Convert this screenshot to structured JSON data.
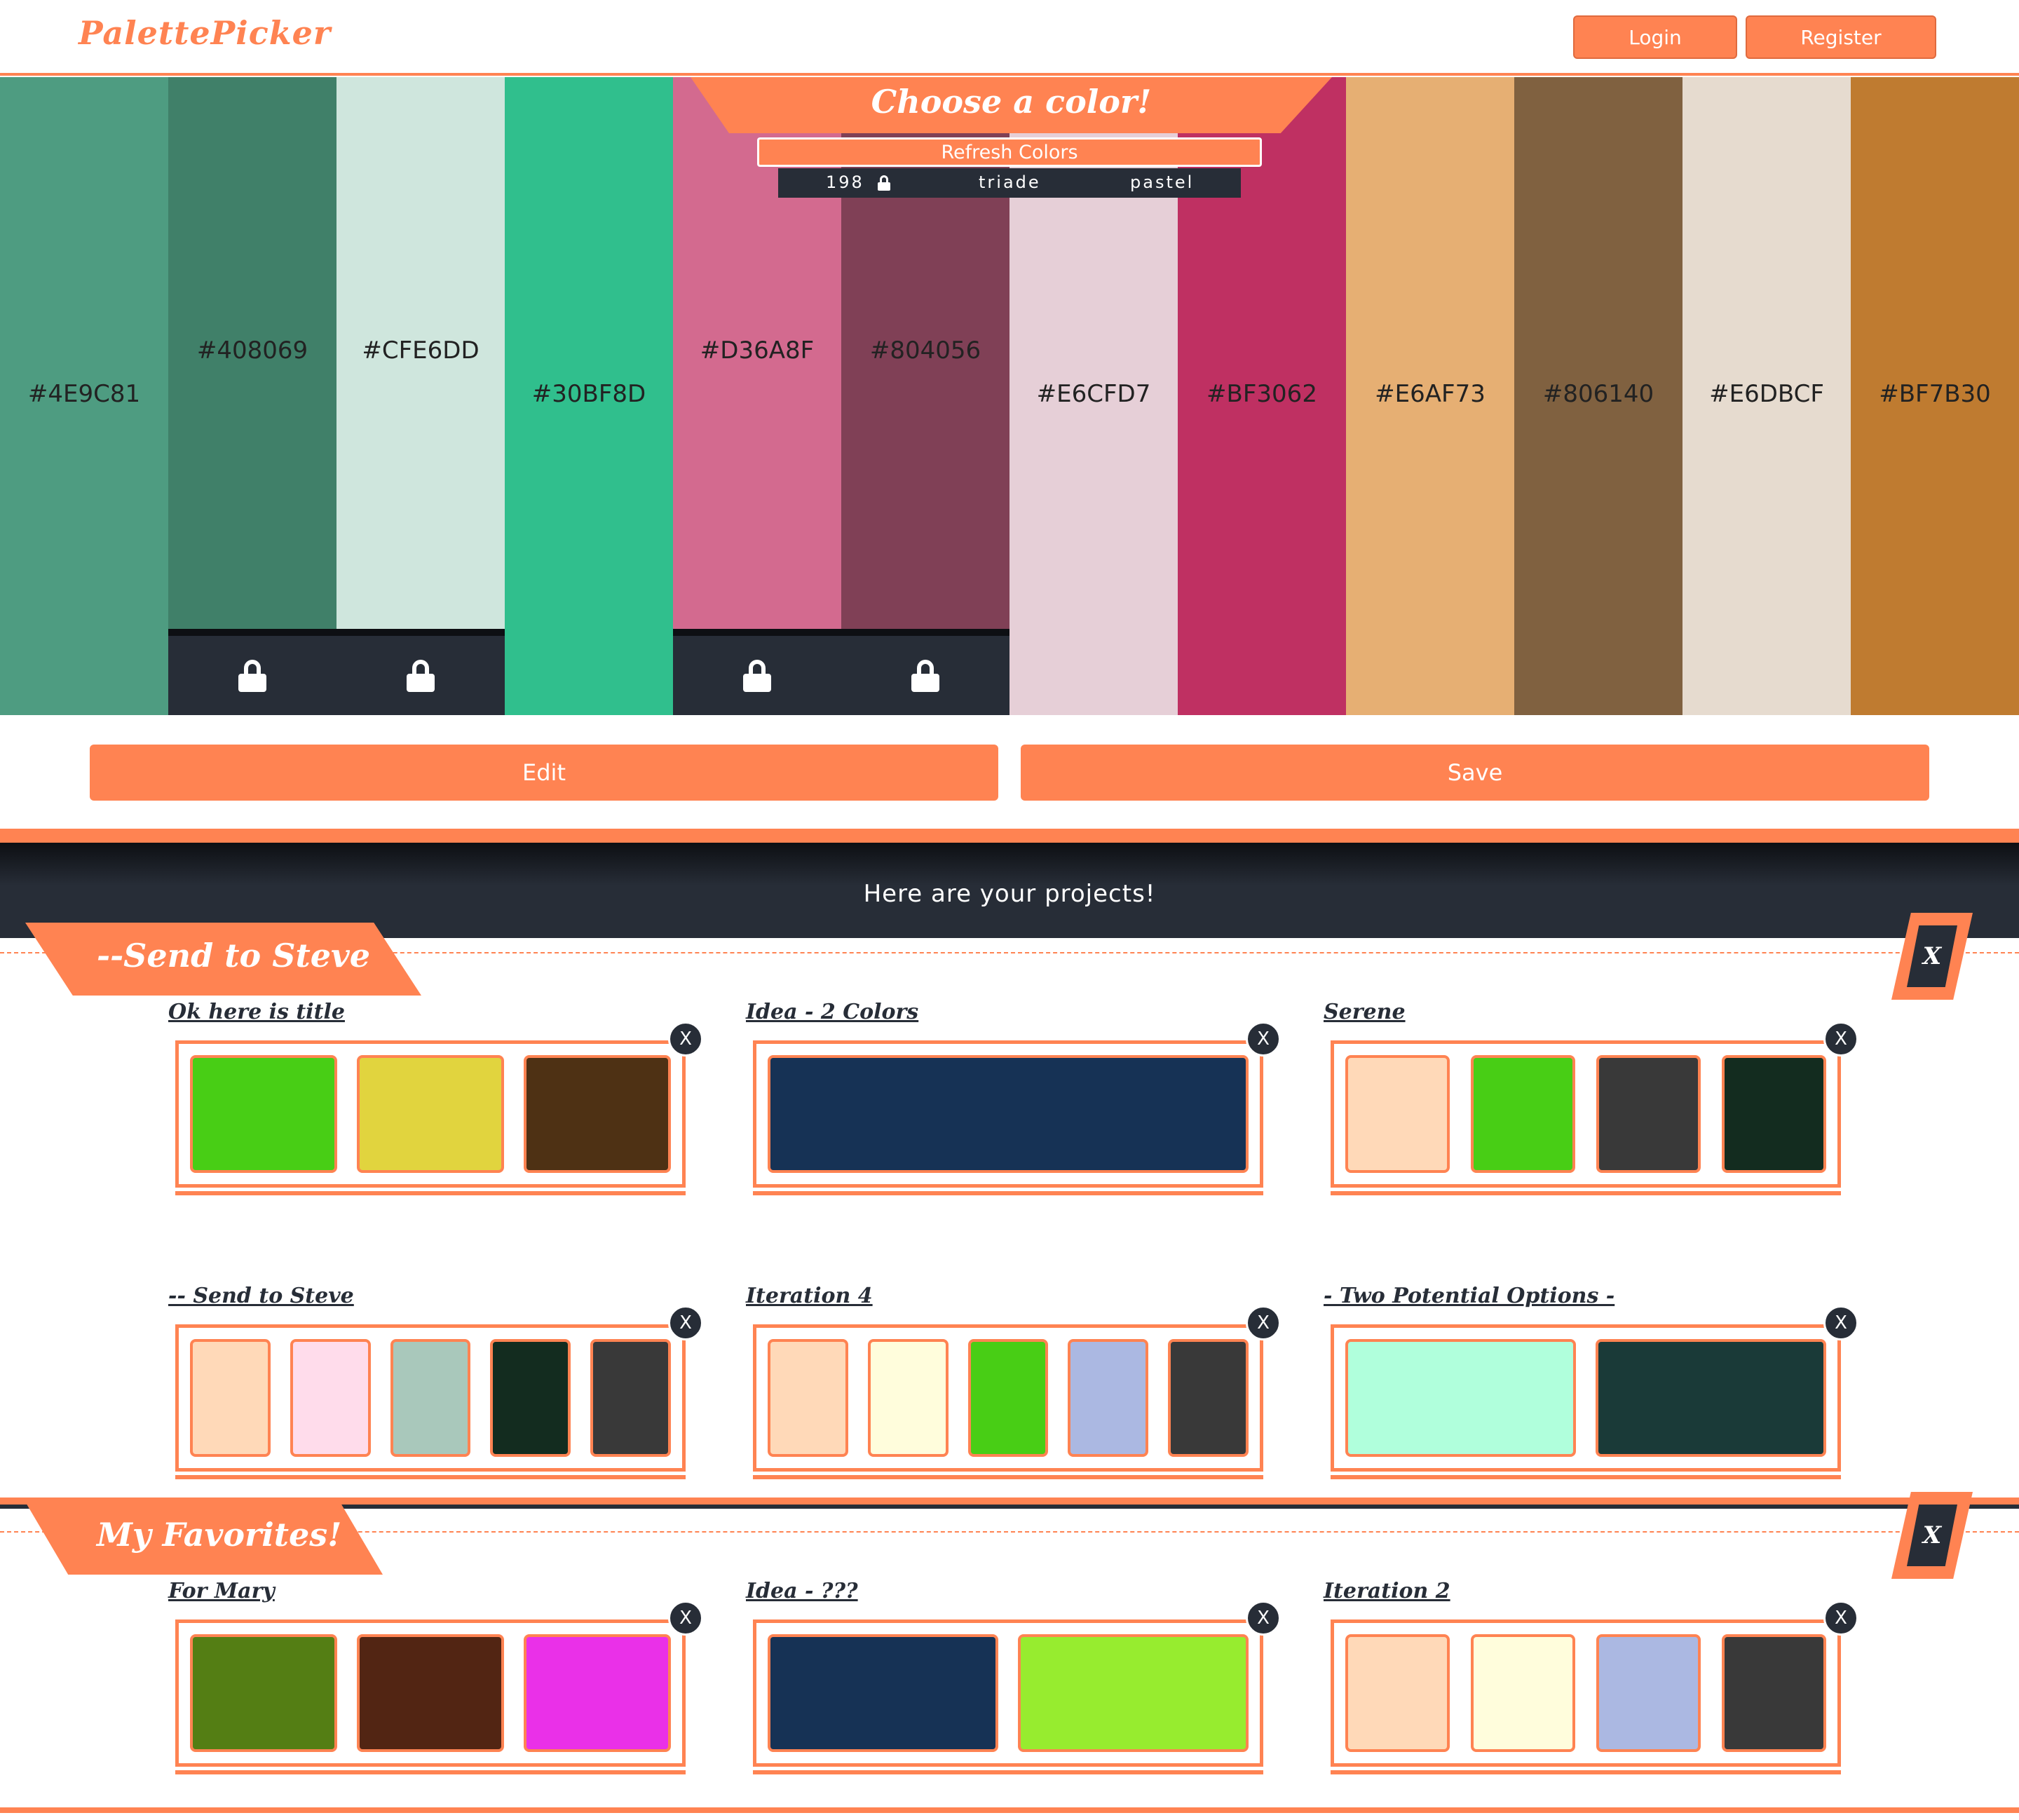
{
  "header": {
    "logo": "PalettePicker",
    "login_label": "Login",
    "register_label": "Register"
  },
  "generator": {
    "title": "Choose a color!",
    "refresh_label": "Refresh Colors",
    "info": {
      "count": "198",
      "scheme": "triade",
      "mode": "pastel"
    },
    "swatches": [
      {
        "hex": "#4E9C81",
        "locked": false
      },
      {
        "hex": "#408069",
        "locked": true
      },
      {
        "hex": "#CFE6DD",
        "locked": true
      },
      {
        "hex": "#30BF8D",
        "locked": false
      },
      {
        "hex": "#D36A8F",
        "locked": true
      },
      {
        "hex": "#804056",
        "locked": true
      },
      {
        "hex": "#E6CFD7",
        "locked": false
      },
      {
        "hex": "#BF3062",
        "locked": false
      },
      {
        "hex": "#E6AF73",
        "locked": false
      },
      {
        "hex": "#806140",
        "locked": false
      },
      {
        "hex": "#E6DBCF",
        "locked": false
      },
      {
        "hex": "#BF7B30",
        "locked": false
      }
    ]
  },
  "actions": {
    "edit_label": "Edit",
    "save_label": "Save"
  },
  "projects": {
    "heading": "Here are your projects!",
    "groups": [
      {
        "name": "--Send to Steve",
        "close_label": "X",
        "palettes": [
          {
            "title": "Ok here is title",
            "colors": [
              "#48CE15",
              "#E1D43E",
              "#4E3114"
            ],
            "close_label": "X"
          },
          {
            "title": "Idea - 2 Colors",
            "colors": [
              "#163255"
            ],
            "close_label": "X"
          },
          {
            "title": "Serene",
            "colors": [
              "#FFD9B8",
              "#48CE15",
              "#393939",
              "#132C1F"
            ],
            "close_label": "X"
          },
          {
            "title": "-- Send to Steve",
            "colors": [
              "#FFD9B8",
              "#FFDCEB",
              "#A9C8BB",
              "#132C1F",
              "#393939"
            ],
            "close_label": "X"
          },
          {
            "title": "Iteration 4",
            "colors": [
              "#FFD9B8",
              "#FFFDDC",
              "#48CE15",
              "#ABB8E2",
              "#393939"
            ],
            "close_label": "X"
          },
          {
            "title": "- Two Potential Options -",
            "colors": [
              "#B0FFDC",
              "#1A3A38"
            ],
            "close_label": "X"
          }
        ]
      },
      {
        "name": "My Favorites!",
        "close_label": "X",
        "palettes": [
          {
            "title": "For Mary",
            "colors": [
              "#547E14",
              "#522513",
              "#EA30E8"
            ],
            "close_label": "X"
          },
          {
            "title": "Idea - ???",
            "colors": [
              "#163255",
              "#97EC2F"
            ],
            "close_label": "X"
          },
          {
            "title": "Iteration 2",
            "colors": [
              "#FFD9B8",
              "#FFFDDC",
              "#ABB8E2",
              "#393939"
            ],
            "close_label": "X"
          }
        ]
      }
    ]
  }
}
